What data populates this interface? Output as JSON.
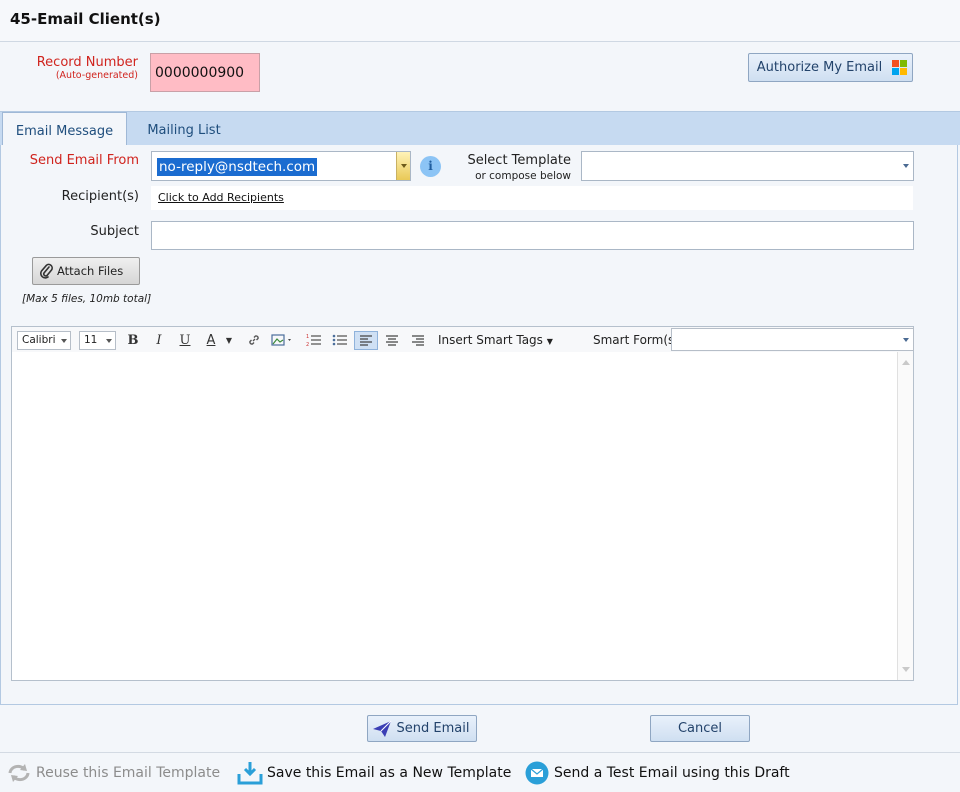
{
  "window": {
    "title": "45-Email Client(s)"
  },
  "record": {
    "label": "Record Number",
    "sublabel": "(Auto-generated)",
    "value": "0000000900"
  },
  "authorize": {
    "label": "Authorize My Email"
  },
  "tabs": [
    {
      "label": "Email Message",
      "active": true
    },
    {
      "label": "Mailing List",
      "active": false
    }
  ],
  "form": {
    "from_label": "Send Email From",
    "from_value": "no-reply@nsdtech.com",
    "info_glyph": "i",
    "template_label": "Select Template",
    "template_sublabel": "or compose below",
    "template_value": "",
    "recipients_label": "Recipient(s)",
    "recipients_link": "Click to Add Recipients",
    "subject_label": "Subject",
    "subject_value": "",
    "attach_label": "Attach Files",
    "attach_note": "[Max 5 files, 10mb total]"
  },
  "editor": {
    "font": "Calibri",
    "size": "11",
    "bold": "B",
    "italic": "I",
    "underline": "U",
    "font_color": "A",
    "smart_tags": "Insert Smart Tags",
    "smart_forms_label": "Smart Form(s)",
    "smart_forms_value": "",
    "body": ""
  },
  "actions": {
    "send": "Send Email",
    "cancel": "Cancel"
  },
  "footer": {
    "reuse": "Reuse this Email Template",
    "save_template": "Save this Email as a New Template",
    "send_test": "Send a Test Email using this Draft"
  },
  "colors": {
    "accent": "#1b6cd0",
    "required": "#d0241e",
    "record_bg": "#ffbcc5",
    "tabbar": "#c6daf1"
  },
  "icons": [
    "windows-logo-icon",
    "info-icon",
    "paperclip-icon",
    "paper-plane-icon",
    "reuse-icon",
    "download-icon",
    "mail-icon"
  ]
}
